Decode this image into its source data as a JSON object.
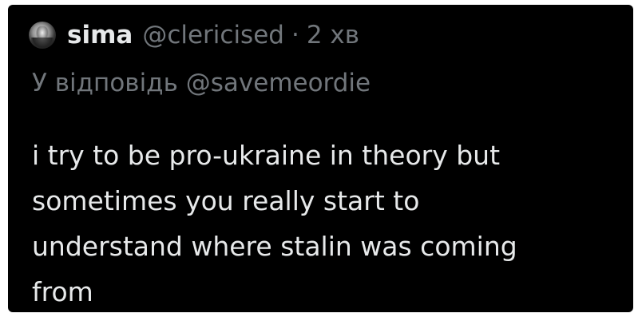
{
  "tweet": {
    "author": {
      "display_name": "sima",
      "handle": "@clericised",
      "avatar_icon": "avatar-photo-icon"
    },
    "separator": "·",
    "timestamp": "2 хв",
    "reply": {
      "prefix": "У відповідь",
      "mention": "@savemeordie"
    },
    "text": "i try to be pro-ukraine in theory but\nsometimes you really start to\nunderstand where stalin was coming\nfrom"
  },
  "colors": {
    "background": "#000000",
    "primary_text": "#e7e9ea",
    "secondary_text": "#71767b"
  }
}
